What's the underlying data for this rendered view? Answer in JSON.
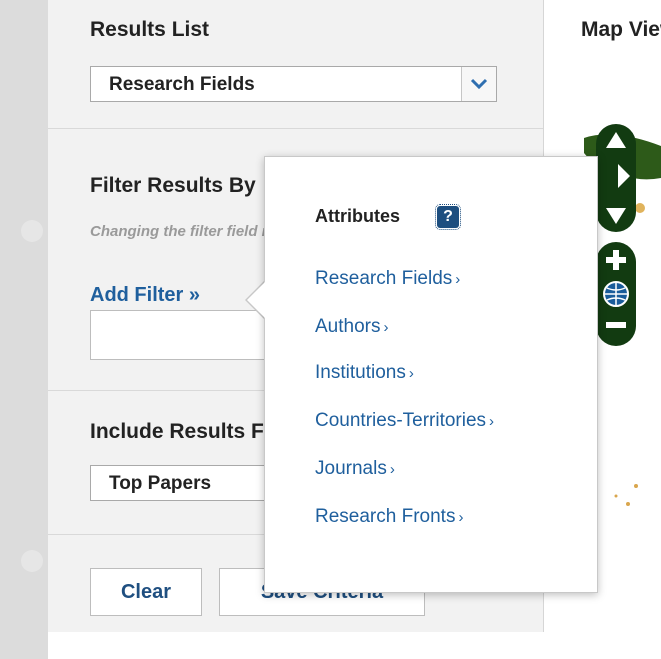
{
  "sidebar": {
    "results_list": {
      "heading": "Results List",
      "selected": "Research Fields"
    },
    "filter": {
      "heading": "Filter Results By",
      "hint": "Changing the filter field resets current filters.",
      "add_filter_label": "Add Filter »",
      "input_value": ""
    },
    "include": {
      "heading": "Include Results For",
      "selected": "Top Papers"
    },
    "buttons": {
      "clear_label": "Clear",
      "save_label": "Save Criteria"
    }
  },
  "map": {
    "title": "Map View"
  },
  "popup": {
    "title": "Attributes",
    "help_label": "?",
    "items": [
      {
        "label": "Research Fields"
      },
      {
        "label": "Authors"
      },
      {
        "label": "Institutions"
      },
      {
        "label": "Countries-Territories"
      },
      {
        "label": "Journals"
      },
      {
        "label": "Research Fronts"
      }
    ],
    "item_caret": "›"
  },
  "colors": {
    "accent": "#1f5f9d",
    "map_control": "#123b11",
    "panel_bg": "#f2f2f2"
  }
}
